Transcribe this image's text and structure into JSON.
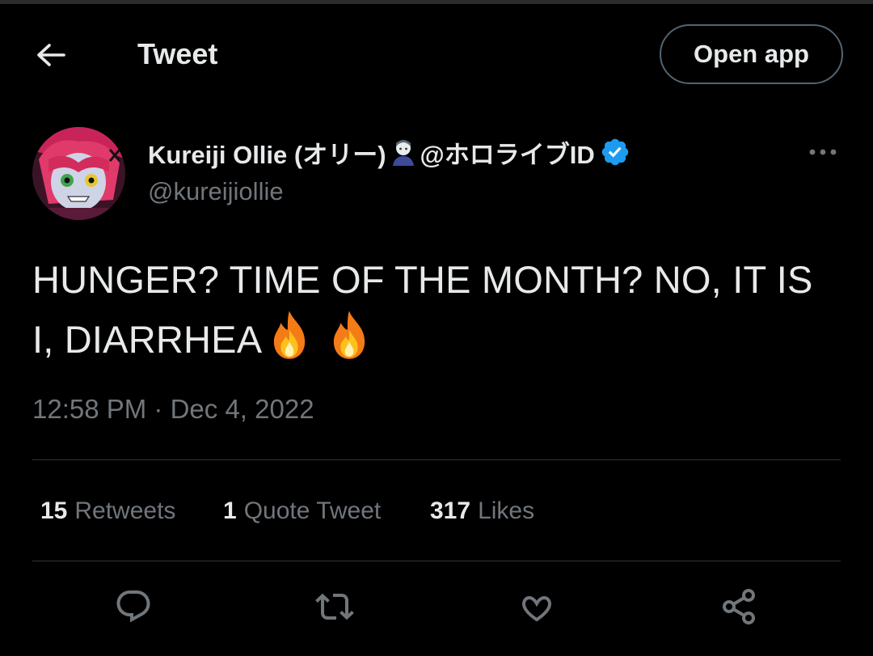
{
  "header": {
    "title": "Tweet",
    "back_icon": "arrow-left-icon",
    "open_app_label": "Open app"
  },
  "author": {
    "name": "Kureiji Ollie (オリー)",
    "name_suffix": "@ホロライブID",
    "handle": "@kureijiollie",
    "verified": true,
    "verified_color": "#1d9bf0"
  },
  "tweet": {
    "text": "HUNGER? TIME OF THE MONTH? NO, IT IS I, DIARRHEA",
    "emoji": [
      "fire",
      "fire"
    ],
    "time": "12:58 PM",
    "separator": "·",
    "date": "Dec 4, 2022"
  },
  "stats": {
    "retweets": {
      "count": "15",
      "label": "Retweets"
    },
    "quotes": {
      "count": "1",
      "label": "Quote Tweet"
    },
    "likes": {
      "count": "317",
      "label": "Likes"
    }
  },
  "actions": [
    "reply-icon",
    "retweet-icon",
    "like-icon",
    "share-icon"
  ],
  "colors": {
    "background": "#000000",
    "text_primary": "#e7e9ea",
    "text_secondary": "#71767b",
    "divider": "#2f3336",
    "accent": "#1d9bf0"
  }
}
